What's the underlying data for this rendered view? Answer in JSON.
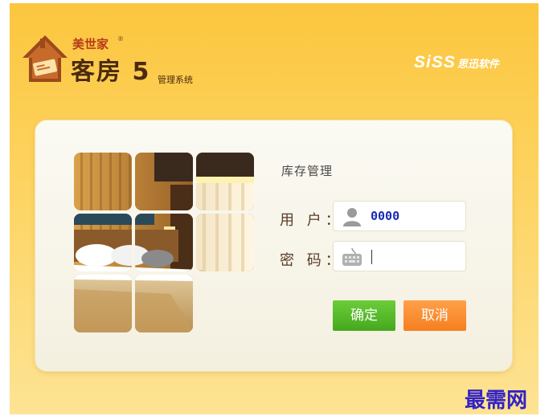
{
  "header": {
    "brand_small": "美世家",
    "brand_registered": "®",
    "product_name": "客房 5",
    "product_sub": "管理系统",
    "vendor_logo": "SiSS",
    "vendor_name": "思迅软件"
  },
  "login": {
    "section_title": "库存管理",
    "user_label": "用 户：",
    "user_value": "0000",
    "password_label": "密 码：",
    "password_value": "",
    "user_icon": "user-icon",
    "keyboard_icon": "keyboard-icon"
  },
  "buttons": {
    "ok_label": "确定",
    "cancel_label": "取消"
  },
  "watermark": "最需网",
  "colors": {
    "background_top": "#fcc63e",
    "background_bottom": "#fde394",
    "ok_button": "#52b424",
    "cancel_button": "#f98a2f",
    "brand_red": "#b7391a",
    "brand_dark": "#4b2a10"
  }
}
